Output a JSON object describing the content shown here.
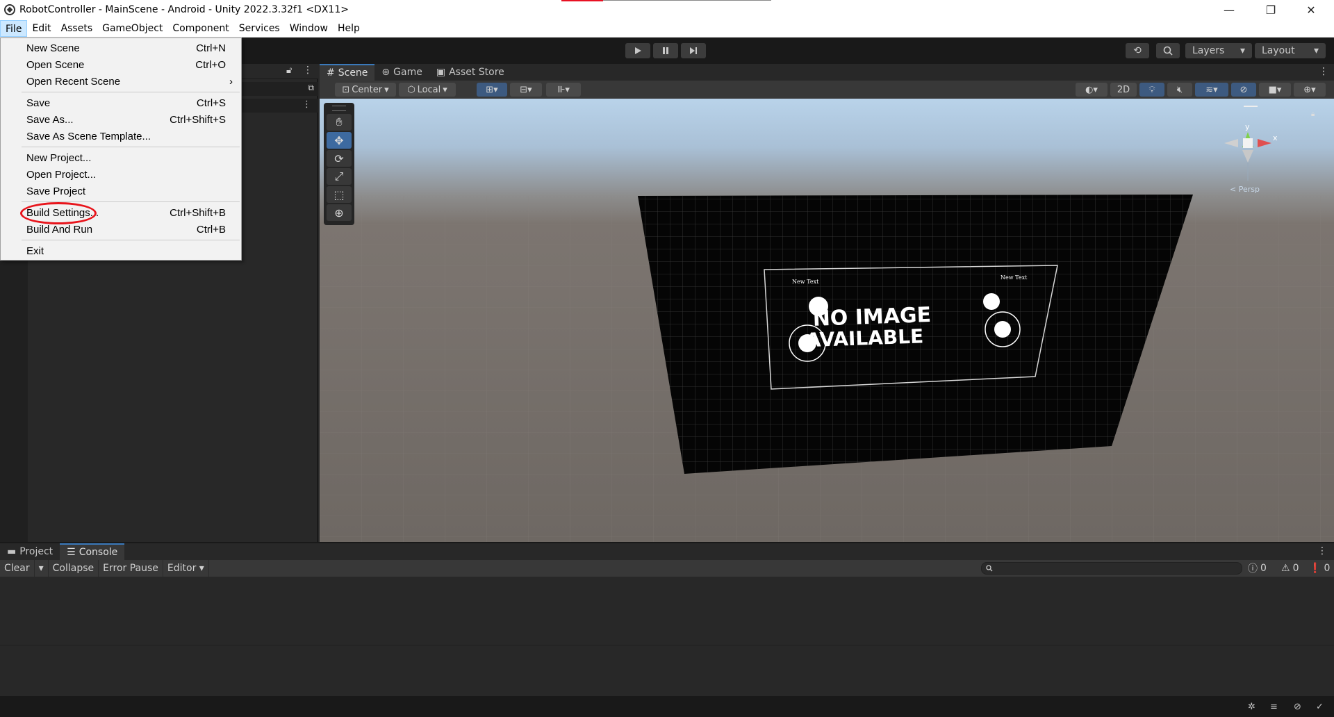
{
  "window": {
    "title": "RobotController - MainScene - Android - Unity 2022.3.32f1 <DX11>",
    "minimize": "—",
    "maximize": "❐",
    "close": "✕"
  },
  "menubar": {
    "items": [
      "File",
      "Edit",
      "Assets",
      "GameObject",
      "Component",
      "Services",
      "Window",
      "Help"
    ]
  },
  "toolbar": {
    "layers_label": "Layers",
    "layout_label": "Layout"
  },
  "file_menu": {
    "new_scene": "New Scene",
    "new_scene_sc": "Ctrl+N",
    "open_scene": "Open Scene",
    "open_scene_sc": "Ctrl+O",
    "open_recent": "Open Recent Scene",
    "open_recent_arrow": "›",
    "save": "Save",
    "save_sc": "Ctrl+S",
    "save_as": "Save As...",
    "save_as_sc": "Ctrl+Shift+S",
    "save_template": "Save As Scene Template...",
    "new_project": "New Project...",
    "open_project": "Open Project...",
    "save_project": "Save Project",
    "build_settings": "Build Settings...",
    "build_settings_sc": "Ctrl+Shift+B",
    "build_run": "Build And Run",
    "build_run_sc": "Ctrl+B",
    "exit": "Exit"
  },
  "scene": {
    "tabs": [
      "Scene",
      "Game",
      "Asset Store"
    ],
    "pivot": "Center",
    "space": "Local",
    "mode_2d": "2D",
    "axis_y": "y",
    "axis_x": "x",
    "persp": "< Persp",
    "canvas_text_left": "New Text",
    "canvas_text_right": "New Text",
    "image_text_line1": "NO IMAGE",
    "image_text_line2": "AVAILABLE"
  },
  "bottom": {
    "tabs": [
      "Project",
      "Console"
    ],
    "clear": "Clear",
    "collapse": "Collapse",
    "error_pause": "Error Pause",
    "editor": "Editor",
    "log_count": "0",
    "warn_count": "0",
    "error_count": "0"
  }
}
